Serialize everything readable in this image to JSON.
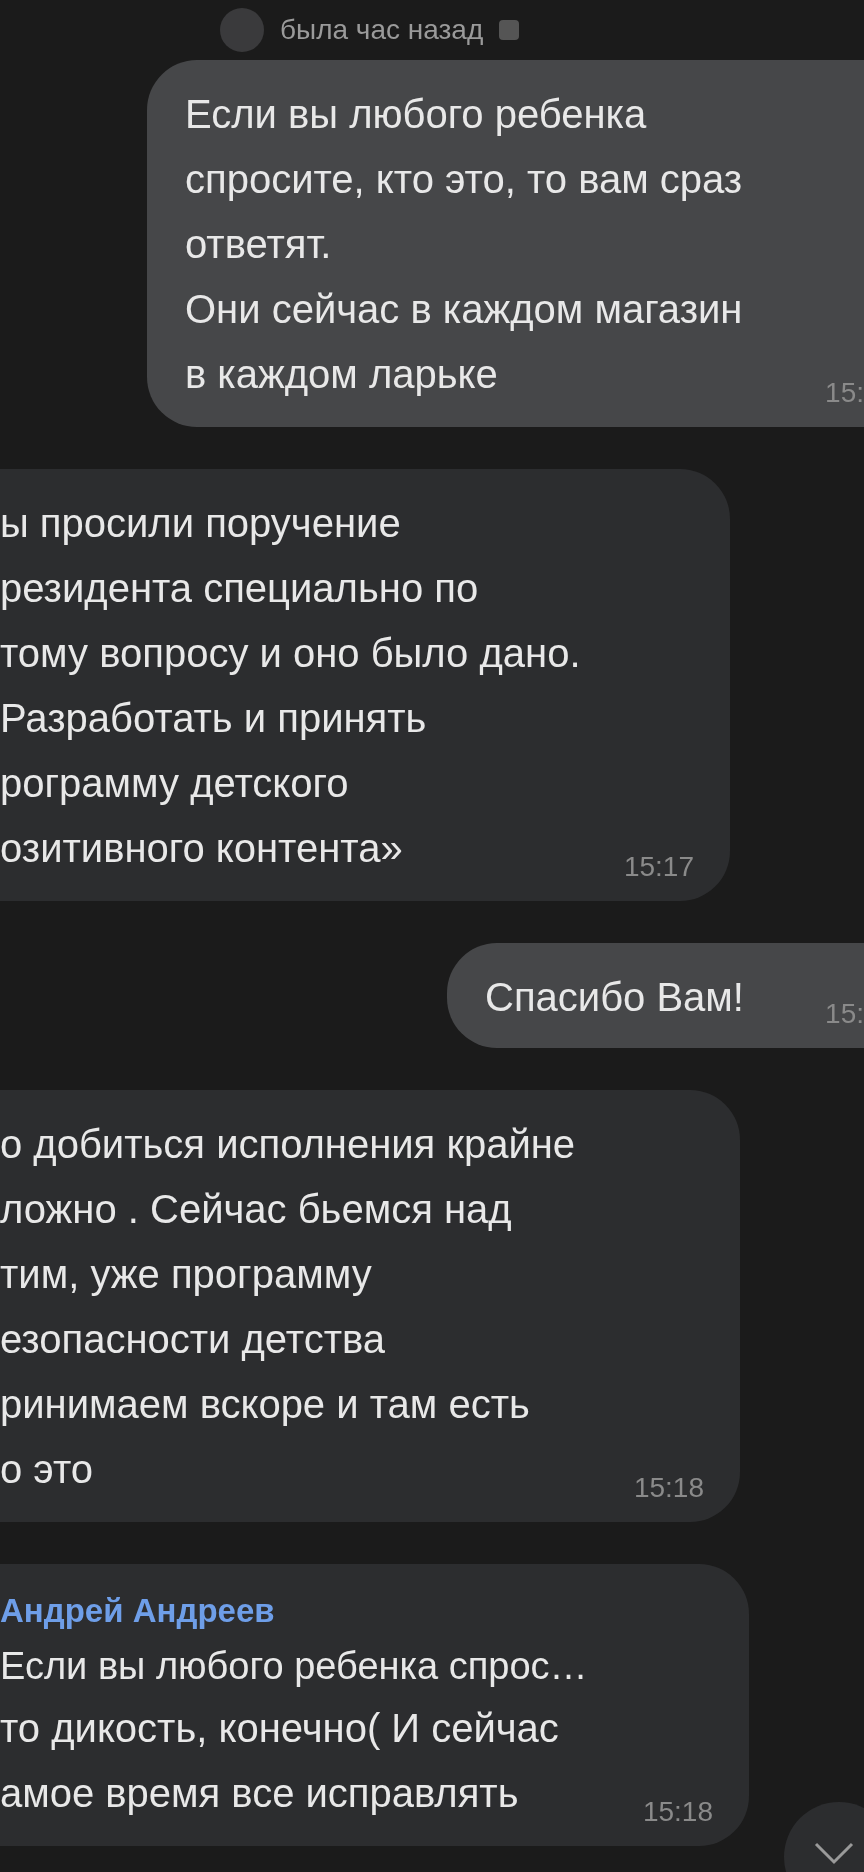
{
  "header": {
    "status": "была час назад"
  },
  "messages": [
    {
      "kind": "outgoing",
      "lines": [
        "Если вы любого ребенка",
        "спросите, кто это, то вам сраз",
        "ответят.",
        "Они сейчас в каждом магазин",
        "в каждом ларьке"
      ],
      "time": "15:"
    },
    {
      "kind": "incoming",
      "lines": [
        "ы просили поручение",
        "резидента специально по",
        "тому вопросу и оно было дано.",
        "Разработать и принять",
        "рограмму детского",
        "озитивного контента»"
      ],
      "time": "15:17"
    },
    {
      "kind": "outgoing",
      "lines": [
        "Спасибо Вам!"
      ],
      "time": "15:"
    },
    {
      "kind": "incoming",
      "lines": [
        "о добиться исполнения крайне",
        "ложно . Сейчас бьемся над",
        "тим, уже программу",
        "езопасности детства",
        "ринимаем вскоре и там есть",
        "о это"
      ],
      "time": "15:18"
    },
    {
      "kind": "incoming",
      "reply": {
        "name": "Андрей Андреев",
        "text": "Если вы любого ребенка спрос…"
      },
      "lines": [
        "то дикость, конечно( И сейчас",
        "амое время все исправлять"
      ],
      "time": "15:18"
    }
  ]
}
